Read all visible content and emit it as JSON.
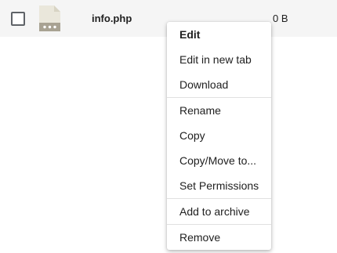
{
  "file": {
    "name": "info.php",
    "size": "0 B",
    "selected": false,
    "icon": "php-file-icon"
  },
  "context_menu": {
    "items": [
      {
        "label": "Edit"
      },
      {
        "label": "Edit in new tab"
      },
      {
        "label": "Download"
      },
      {
        "label": "Rename"
      },
      {
        "label": "Copy"
      },
      {
        "label": "Copy/Move to..."
      },
      {
        "label": "Set Permissions"
      },
      {
        "label": "Add to archive"
      },
      {
        "label": "Remove"
      }
    ]
  }
}
